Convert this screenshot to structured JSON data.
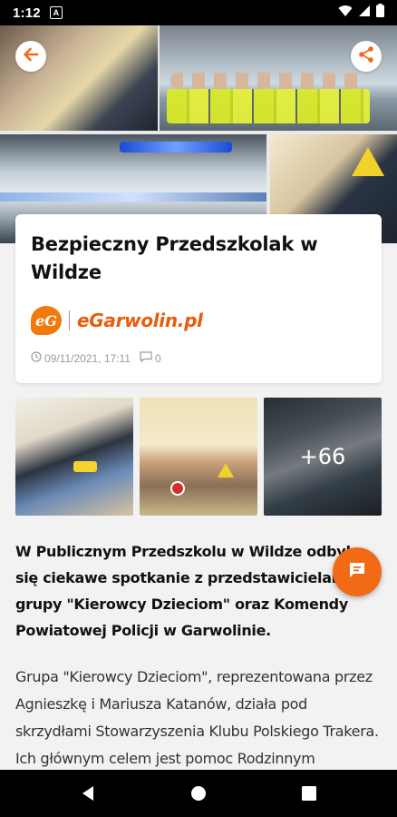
{
  "status_bar": {
    "time": "1:12",
    "app_icon_label": "A",
    "icons": [
      "wifi-icon",
      "signal-icon",
      "battery-icon"
    ]
  },
  "hero": {
    "images": [
      "photo-classroom-officer",
      "photo-group-vests",
      "photo-police-car",
      "photo-officer-child"
    ]
  },
  "article": {
    "title": "Bezpieczny Przedszkolak w Wildze",
    "source_logo_text": "eG",
    "source_name": "eGarwolin.pl",
    "date": "09/11/2021, 17:11",
    "comments_count": "0",
    "lead": "W Publicznym Przedszkolu w Wildze odbyło się ciekawe spotkanie z przedstawicielami grupy \"Kierowcy Dzieciom\" oraz Komendy Powiatowej Policji w Garwolinie.",
    "paragraph": "Grupa \"Kierowcy Dzieciom\", reprezentowana przez Agnieszkę i Mariusza Katanów, działa pod skrzydłami Stowarzyszenia Klubu Polskiego Trakera. Ich głównym celem jest pomoc Rodzinnym"
  },
  "gallery": {
    "more_label": "+66"
  },
  "colors": {
    "accent": "#f26a16",
    "brand_orange": "#e85d0a",
    "meta_gray": "#9a9a9a"
  }
}
